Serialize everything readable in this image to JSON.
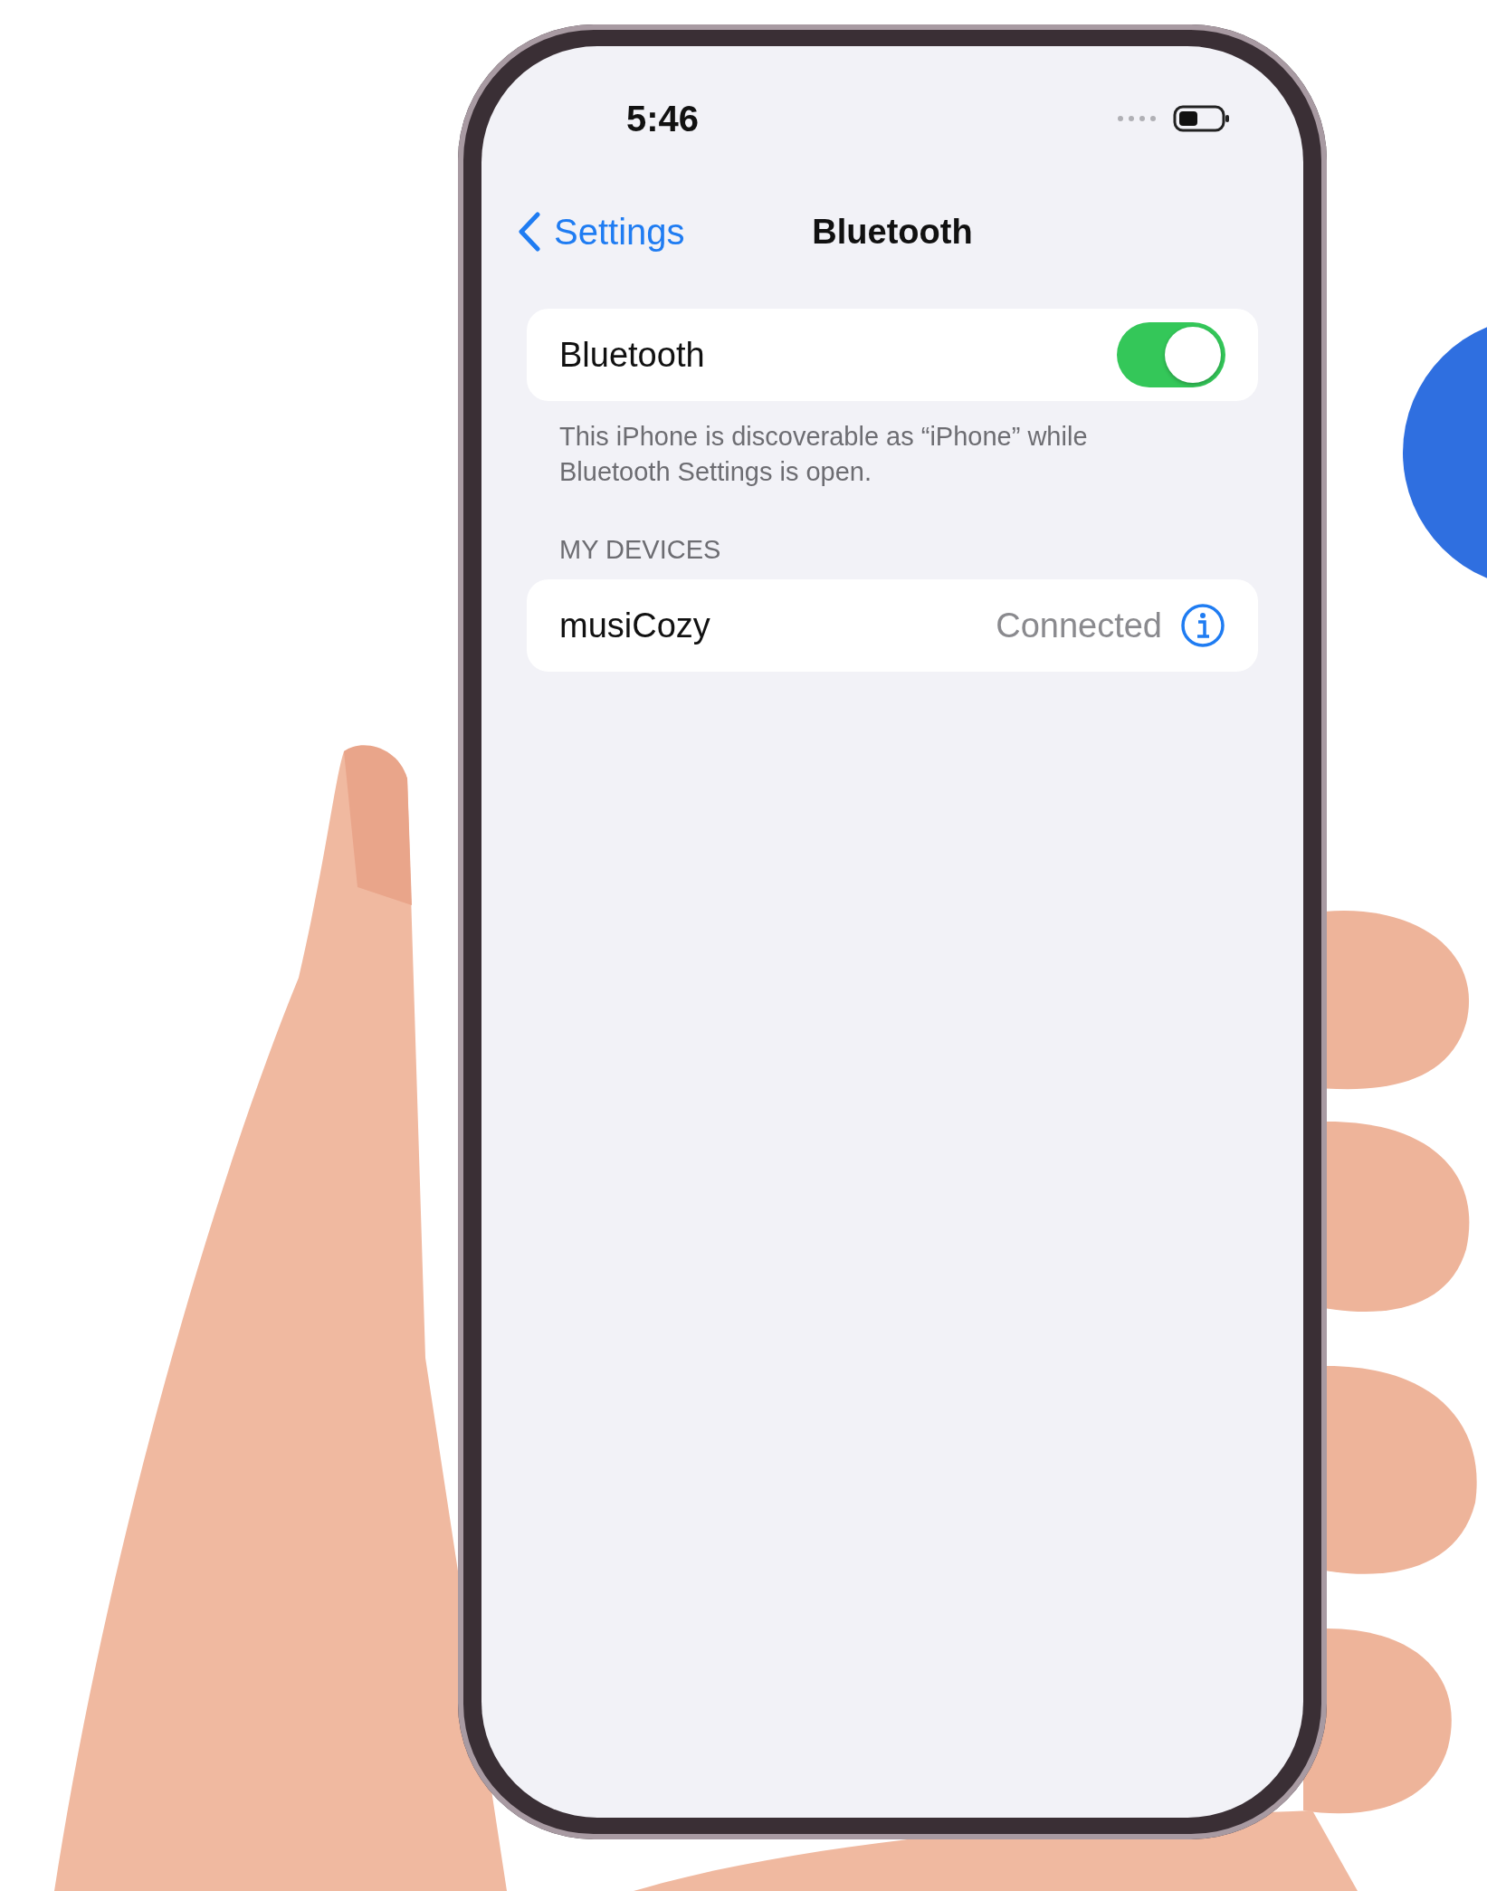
{
  "status_bar": {
    "time": "5:46"
  },
  "nav": {
    "back": "Settings",
    "title": "Bluetooth"
  },
  "bluetooth": {
    "label": "Bluetooth",
    "on": true,
    "footer": "This iPhone is discoverable as “iPhone” while Bluetooth Settings is open."
  },
  "my_devices": {
    "header": "MY DEVICES",
    "devices": [
      {
        "name": "musiCozy",
        "status": "Connected"
      }
    ]
  }
}
